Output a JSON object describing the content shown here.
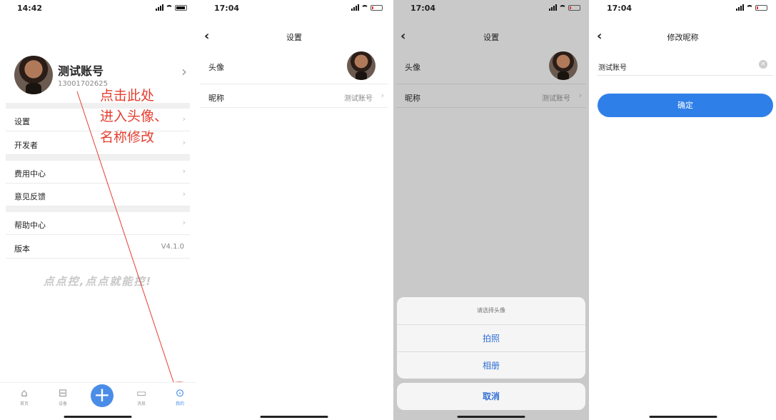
{
  "screen1": {
    "time": "14:42",
    "profile": {
      "name": "测试账号",
      "phone": "13001702625",
      "arrow": "›"
    },
    "annotation": [
      "点击此处",
      "进入头像、",
      "名称修改"
    ],
    "menu": [
      {
        "label": "设置",
        "arrow": "›"
      },
      {
        "label": "开发者",
        "arrow": "›"
      },
      {
        "label": "费用中心",
        "arrow": "›"
      },
      {
        "label": "意见反馈",
        "arrow": "›"
      },
      {
        "label": "帮助中心",
        "arrow": "›"
      },
      {
        "label": "版本",
        "value": "V4.1.0"
      }
    ],
    "slogan": "点点控,点点就能控!",
    "tabs": [
      {
        "label": "首页",
        "icon": "⌂"
      },
      {
        "label": "设备",
        "icon": "⊟"
      },
      {
        "label": "消息",
        "icon": "▭"
      },
      {
        "label": "我的",
        "icon": "⊙"
      }
    ],
    "plus": "+"
  },
  "screen2": {
    "time": "17:04",
    "back": "‹",
    "title": "设置",
    "rows": [
      {
        "label": "头像"
      },
      {
        "label": "昵称",
        "value": "测试账号",
        "arrow": "›"
      }
    ]
  },
  "screen3": {
    "time": "17:04",
    "back": "‹",
    "title": "设置",
    "rows": [
      {
        "label": "头像"
      },
      {
        "label": "昵称",
        "value": "测试账号",
        "arrow": "›"
      }
    ],
    "sheet": {
      "title": "请选择头像",
      "options": [
        "拍照",
        "相册"
      ],
      "cancel": "取消"
    }
  },
  "screen4": {
    "time": "17:04",
    "back": "‹",
    "title": "修改昵称",
    "input_value": "测试账号",
    "clear": "×",
    "confirm": "确定"
  }
}
